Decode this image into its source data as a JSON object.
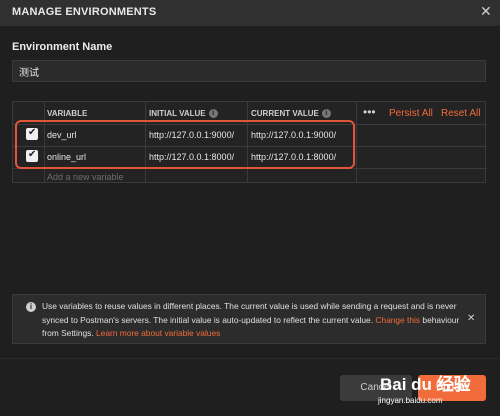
{
  "dialog": {
    "title": "MANAGE ENVIRONMENTS",
    "close_icon": "close-icon"
  },
  "env": {
    "label": "Environment Name",
    "value": "测试"
  },
  "table": {
    "headers": {
      "variable": "VARIABLE",
      "initial": "INITIAL VALUE",
      "current": "CURRENT VALUE"
    },
    "info_icon": "info-icon",
    "more_icon": "•••",
    "persist_all": "Persist All",
    "reset_all": "Reset All",
    "rows": [
      {
        "checked": true,
        "variable": "dev_url",
        "initial": "http://127.0.0.1:9000/",
        "current": "http://127.0.0.1:9000/"
      },
      {
        "checked": true,
        "variable": "online_url",
        "initial": "http://127.0.0.1:8000/",
        "current": "http://127.0.0.1:8000/"
      }
    ],
    "add_placeholder": "Add a new variable"
  },
  "info": {
    "text_a": "Use variables to reuse values in different places. The current value is used while sending a request and is never synced to Postman's servers. The initial value is auto-updated to reflect the current value. ",
    "link_change": "Change this",
    "text_b": " behaviour from Settings. ",
    "link_learn": "Learn more about variable values",
    "close": "✕"
  },
  "footer": {
    "cancel": "Cancel",
    "update": "Update"
  },
  "watermark": {
    "main": "Bai du 经验",
    "sub": "jingyan.baidu.com"
  },
  "colors": {
    "accent": "#f26b3a",
    "highlight_border": "#e0553b",
    "background": "#1f1f1f"
  }
}
